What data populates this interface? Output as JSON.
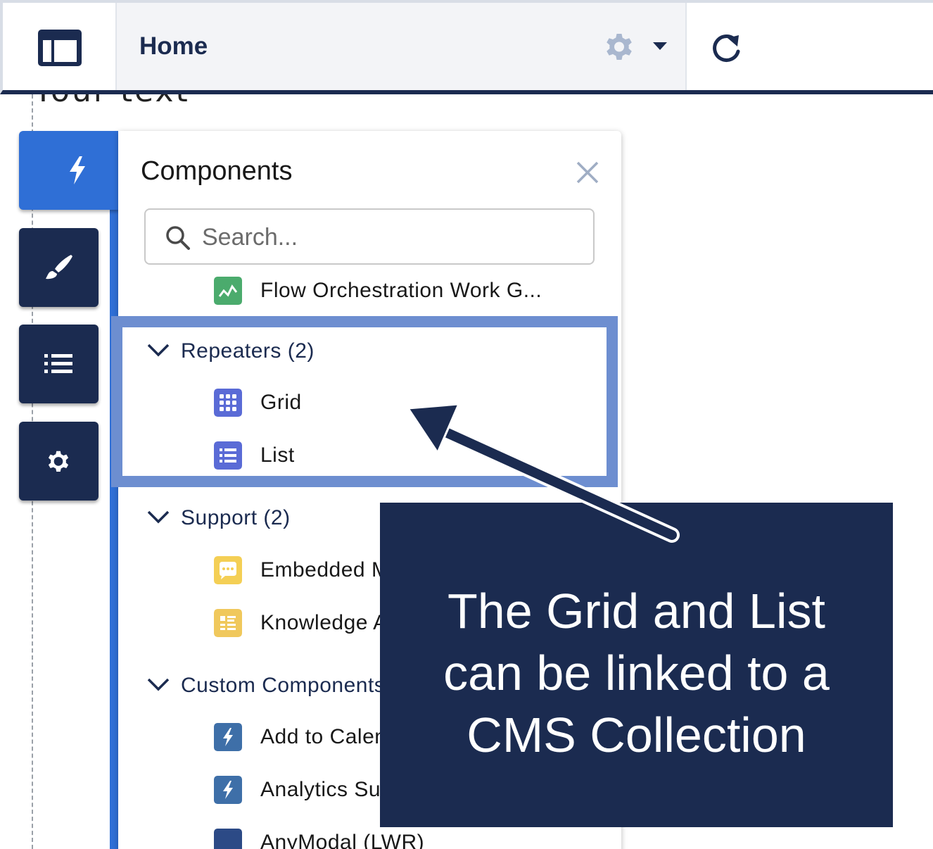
{
  "topbar": {
    "logo_icon": "layout-panel-icon",
    "page_label": "Home",
    "settings_icon": "gear-icon",
    "dropdown_icon": "caret-down-icon",
    "refresh_icon": "refresh-icon"
  },
  "canvas": {
    "text": "Your text"
  },
  "rail": {
    "items": [
      {
        "icon": "lightning-icon",
        "active": true
      },
      {
        "icon": "paintbrush-icon",
        "active": false
      },
      {
        "icon": "list-icon",
        "active": false
      },
      {
        "icon": "gear-icon",
        "active": false
      }
    ]
  },
  "panel": {
    "title": "Components",
    "close_icon": "close-icon",
    "search_placeholder": "Search...",
    "items": {
      "flow": "Flow Orchestration Work G...",
      "grid": "Grid",
      "list": "List",
      "embedded": "Embedded M",
      "knowledge": "Knowledge A",
      "add_to_calendar": "Add to Calen",
      "analytics": "Analytics Su",
      "anymodal": "AnyModal (LWR)"
    },
    "sections": {
      "repeaters": "Repeaters (2)",
      "support": "Support (2)",
      "custom": "Custom Components"
    }
  },
  "colors": {
    "navy": "#1b2b50",
    "accent_blue": "#2f6fd6",
    "highlight_blue": "#6d8ed0",
    "repeater_icon": "#5a6bd6",
    "support_icon": "#f4cf55",
    "flow_icon": "#4bab6d",
    "custom_icon": "#3e6fa8"
  },
  "callout": {
    "text": "The Grid and List\ncan be linked to a\nCMS Collection"
  }
}
